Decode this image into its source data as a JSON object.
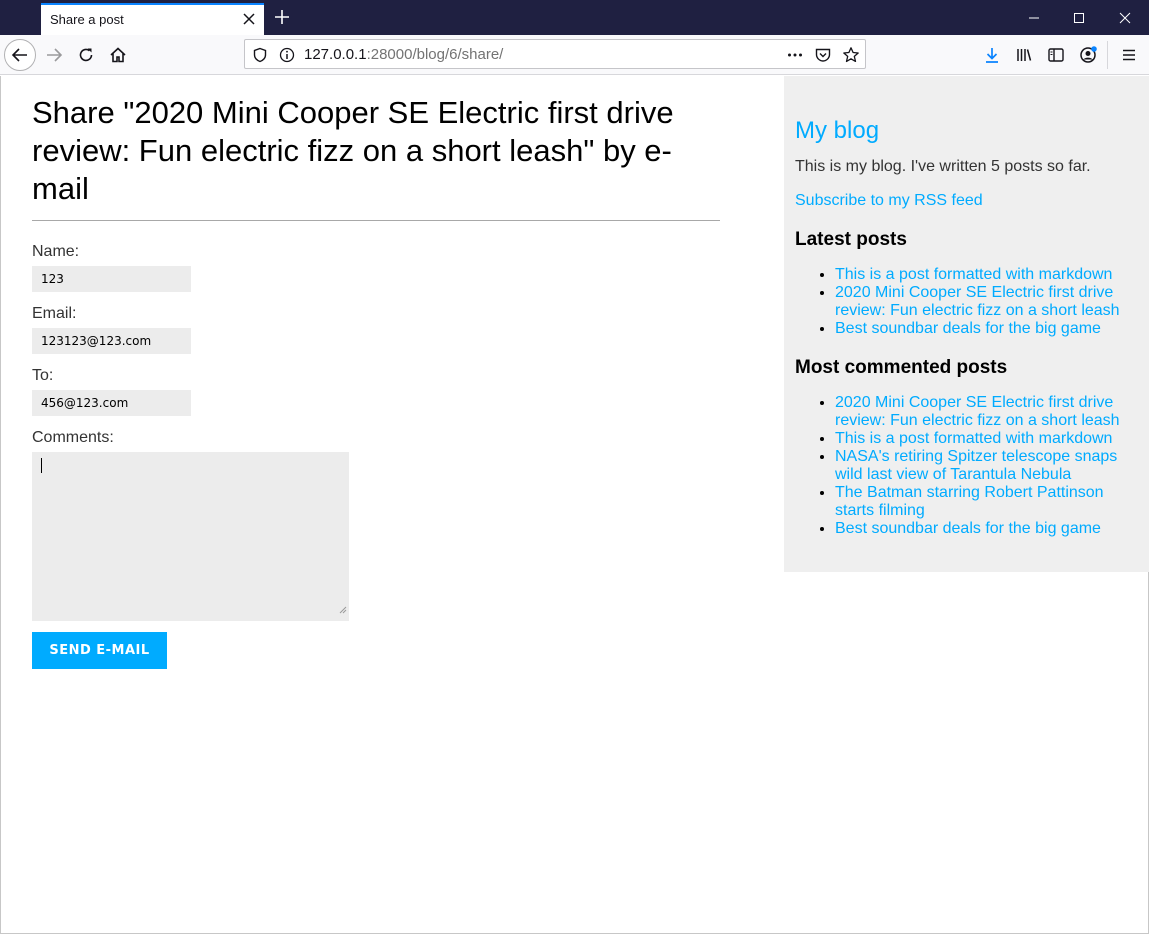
{
  "browser": {
    "tab_title": "Share a post",
    "url_host": "127.0.0.1",
    "url_rest": ":28000/blog/6/share/"
  },
  "page": {
    "title": "Share \"2020 Mini Cooper SE Electric first drive review: Fun electric fizz on a short leash\" by e-mail",
    "form": {
      "name_label": "Name:",
      "name_value": "123",
      "email_label": "Email:",
      "email_value": "123123@123.com",
      "to_label": "To:",
      "to_value": "456@123.com",
      "comments_label": "Comments:",
      "comments_value": "",
      "submit_label": "SEND E-MAIL"
    }
  },
  "sidebar": {
    "title": "My blog",
    "description": "This is my blog. I've written 5 posts so far.",
    "rss_link": "Subscribe to my RSS feed",
    "latest_heading": "Latest posts",
    "latest_posts": [
      "This is a post formatted with markdown",
      "2020 Mini Cooper SE Electric first drive review: Fun electric fizz on a short leash",
      "Best soundbar deals for the big game"
    ],
    "commented_heading": "Most commented posts",
    "commented_posts": [
      "2020 Mini Cooper SE Electric first drive review: Fun electric fizz on a short leash",
      "This is a post formatted with markdown",
      "NASA's retiring Spitzer telescope snaps wild last view of Tarantula Nebula",
      "The Batman starring Robert Pattinson starts filming",
      "Best soundbar deals for the big game"
    ]
  },
  "colors": {
    "accent": "#00abff",
    "titlebar": "#1f2041",
    "input_bg": "#ececec",
    "sidebar_bg": "#efefef"
  }
}
